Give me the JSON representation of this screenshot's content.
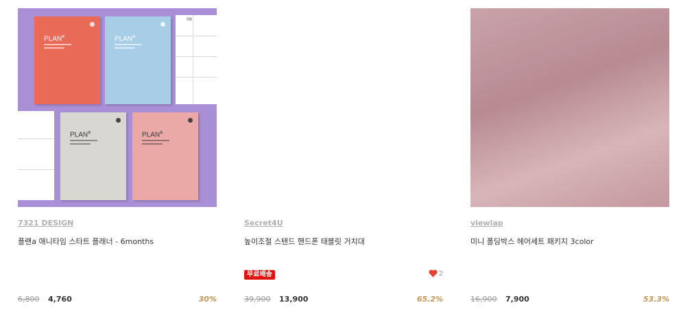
{
  "products": [
    {
      "brand": "7321 DESIGN",
      "title": "플랜a 애니타임 스타트 플래너 - 6months",
      "price_original": "6,800",
      "price_sale": "4,760",
      "discount": "30%",
      "image_alt": "planner-image"
    },
    {
      "brand": "Secret4U",
      "title": "높이조절 스탠드 핸드폰 태블릿 거치대",
      "badge": "무료배송",
      "likes": "2",
      "price_original": "39,900",
      "price_sale": "13,900",
      "discount": "65.2%",
      "image_alt": "stand-image"
    },
    {
      "brand": "viewlap",
      "title": "미니 폴딩박스 헤어세트 패키지 3color",
      "price_original": "16,900",
      "price_sale": "7,900",
      "discount": "53.3%",
      "image_alt": "hair-set-image"
    }
  ],
  "planner_cover": {
    "text": "PLAN",
    "sup": "a",
    "page_number": "08"
  },
  "colors": {
    "brand_text": "#b0b0b0",
    "discount": "#c29656",
    "badge": "#e0130e",
    "heart": "#e8412c"
  }
}
